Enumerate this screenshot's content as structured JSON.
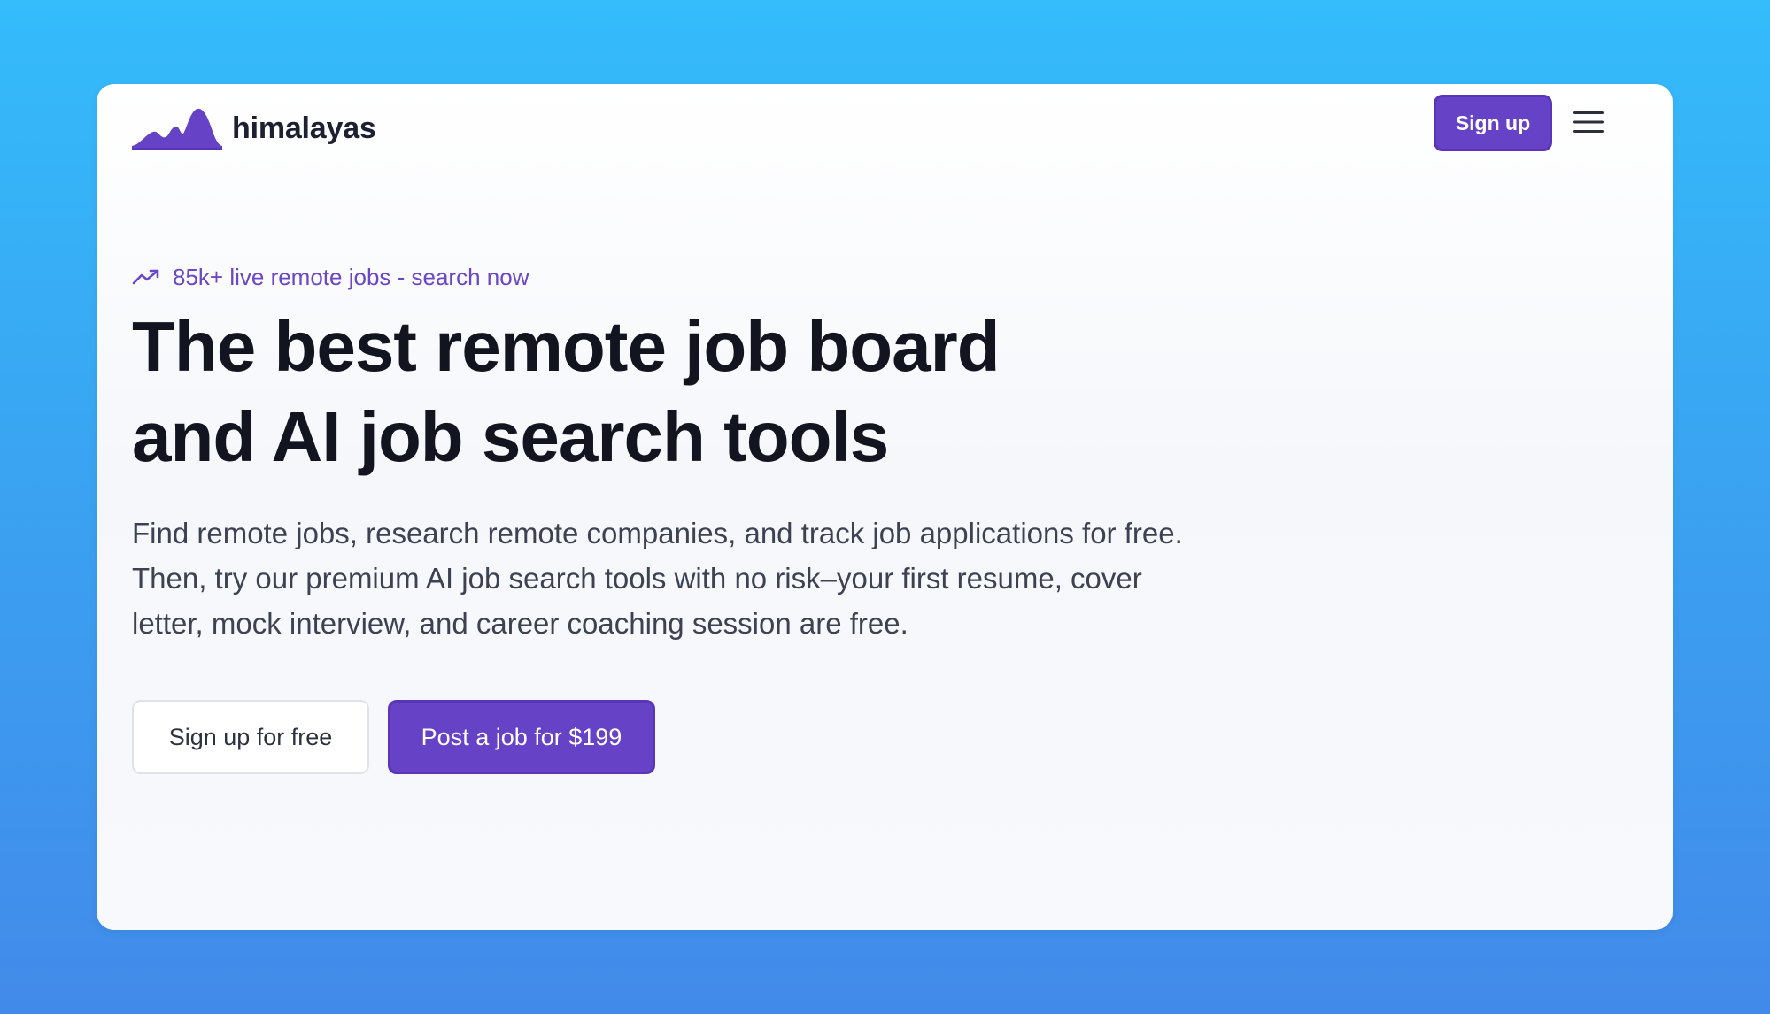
{
  "brand": {
    "name": "himalayas",
    "logo_icon": "mountain-logo-icon",
    "accent_color": "#6642c7"
  },
  "header": {
    "signup_label": "Sign up",
    "menu_icon": "hamburger-menu-icon"
  },
  "hero": {
    "kicker_icon": "trending-up-icon",
    "kicker_text": "85k+ live remote jobs - search now",
    "headline_lines": [
      "The best remote job board",
      "and AI job search tools"
    ],
    "description_lines": [
      "Find remote jobs, research remote companies, and track job applications for free.",
      "Then, try our premium AI job search tools with no risk–your first resume, cover",
      "letter, mock interview, and career coaching session are free."
    ],
    "cta_secondary_label": "Sign up for free",
    "cta_primary_label": "Post a job for $199"
  }
}
